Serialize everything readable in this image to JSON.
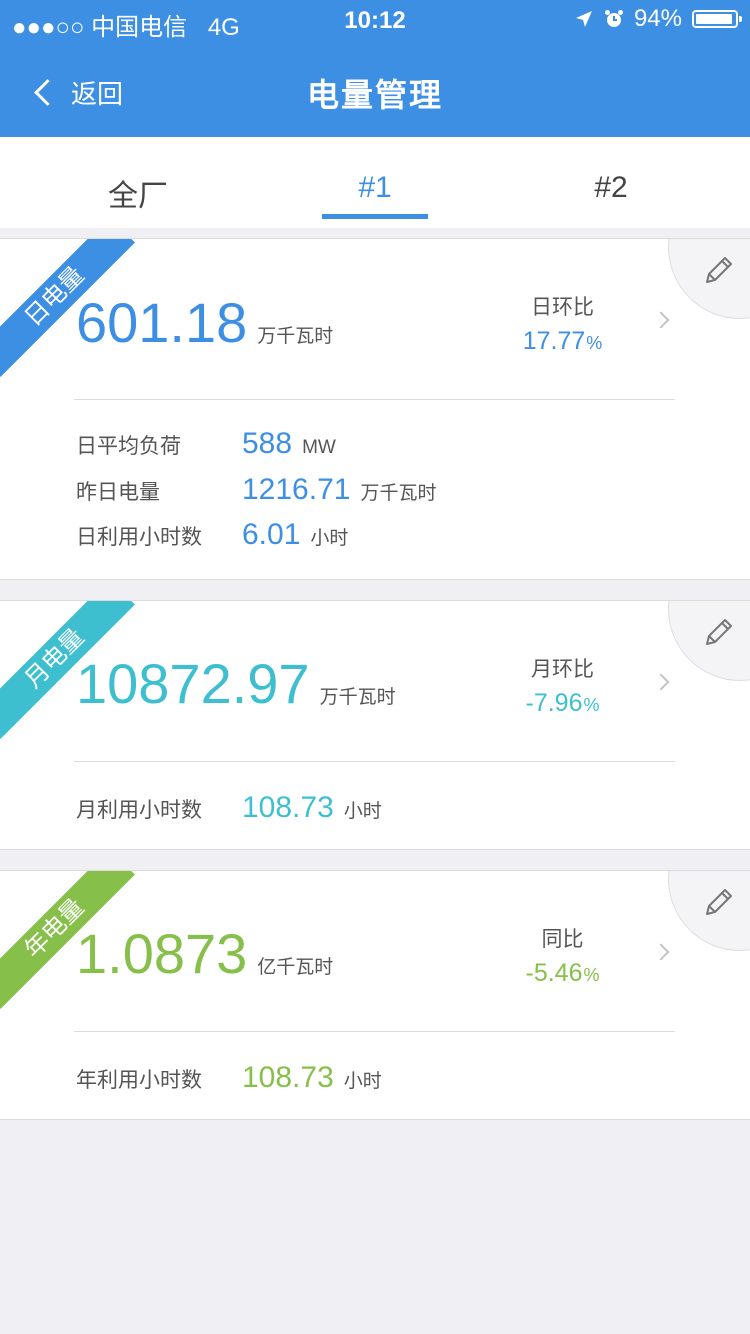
{
  "status_bar": {
    "signal_dots": "●●●○○",
    "carrier": "中国电信",
    "network": "4G",
    "time": "10:12",
    "battery": "94%"
  },
  "nav": {
    "back_label": "返回",
    "title": "电量管理"
  },
  "tabs": [
    {
      "label": "全厂",
      "active": false
    },
    {
      "label": "#1",
      "active": true
    },
    {
      "label": "#2",
      "active": false
    }
  ],
  "colors": {
    "primary": "#3d8fe4",
    "daily": "#3d8fe4",
    "monthly": "#3dbfcf",
    "yearly": "#86c04a"
  },
  "cards": {
    "daily": {
      "ribbon": "日电量",
      "main_value": "601.18",
      "main_unit": "万千瓦时",
      "compare_label": "日环比",
      "compare_value": "17.77",
      "compare_unit": "%",
      "rows": [
        {
          "label": "日平均负荷",
          "value": "588",
          "unit": "MW"
        },
        {
          "label": "昨日电量",
          "value": "1216.71",
          "unit": "万千瓦时"
        },
        {
          "label": "日利用小时数",
          "value": "6.01",
          "unit": "小时"
        }
      ]
    },
    "monthly": {
      "ribbon": "月电量",
      "main_value": "10872.97",
      "main_unit": "万千瓦时",
      "compare_label": "月环比",
      "compare_value": "-7.96",
      "compare_unit": "%",
      "rows": [
        {
          "label": "月利用小时数",
          "value": "108.73",
          "unit": "小时"
        }
      ]
    },
    "yearly": {
      "ribbon": "年电量",
      "main_value": "1.0873",
      "main_unit": "亿千瓦时",
      "compare_label": "同比",
      "compare_value": "-5.46",
      "compare_unit": "%",
      "rows": [
        {
          "label": "年利用小时数",
          "value": "108.73",
          "unit": "小时"
        }
      ]
    }
  }
}
